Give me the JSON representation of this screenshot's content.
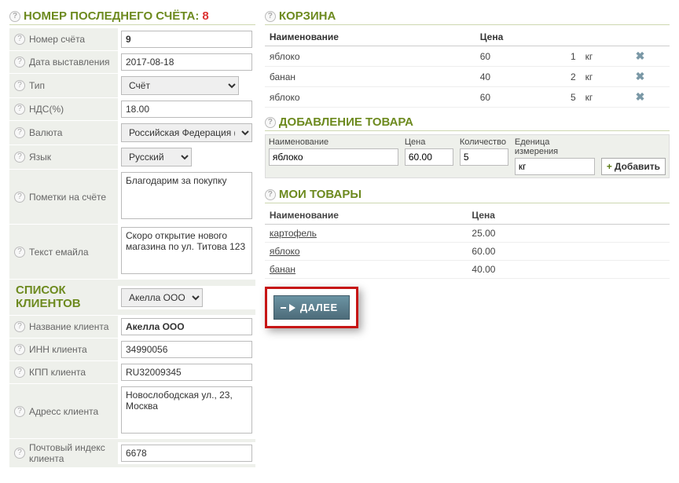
{
  "left": {
    "lastInvoiceTitle": "НОМЕР ПОСЛЕДНЕГО СЧЁТА:",
    "lastInvoiceNo": "8",
    "rows": {
      "number_label": "Номер счёта",
      "number_value": "9",
      "date_label": "Дата выставления",
      "date_value": "2017-08-18",
      "type_label": "Тип",
      "type_value": "Счёт",
      "vat_label": "НДС(%)",
      "vat_value": "18.00",
      "currency_label": "Валюта",
      "currency_value": "Российская Федерация (RUB) р.",
      "lang_label": "Язык",
      "lang_value": "Русский",
      "note_label": "Пометки на счёте",
      "note_value": "Благодарим за покупку",
      "emailtext_label": "Текст емайла",
      "emailtext_value": "Скоро открытие нового магазина по ул. Титова 123"
    },
    "clientsTitle1": "СПИСОК",
    "clientsTitle2": "КЛИЕНТОВ",
    "clientSelect": "Акелла ООО",
    "client": {
      "name_label": "Название клиента",
      "name_value": "Акелла ООО",
      "inn_label": "ИНН клиента",
      "inn_value": "34990056",
      "kpp_label": "КПП клиента",
      "kpp_value": "RU32009345",
      "addr_label": "Адресс клиента",
      "addr_value": "Новослободская ул., 23, Москва",
      "zip_label": "Почтовый индекс клиента",
      "zip_value": "6678"
    }
  },
  "cart": {
    "title": "КОРЗИНА",
    "th_name": "Наименование",
    "th_price": "Цена",
    "rows": [
      {
        "name": "яблоко",
        "price": "60",
        "qty": "1",
        "unit": "кг"
      },
      {
        "name": "банан",
        "price": "40",
        "qty": "2",
        "unit": "кг"
      },
      {
        "name": "яблоко",
        "price": "60",
        "qty": "5",
        "unit": "кг"
      }
    ]
  },
  "add": {
    "title": "ДОБАВЛЕНИЕ ТОВАРА",
    "th_name": "Наименование",
    "th_price": "Цена",
    "th_qty": "Количество",
    "th_unit": "Еденица измерения",
    "name_value": "яблоко",
    "price_value": "60.00",
    "qty_value": "5",
    "unit_value": "кг",
    "btn": "Добавить"
  },
  "goods": {
    "title": "МОИ ТОВАРЫ",
    "th_name": "Наименование",
    "th_price": "Цена",
    "rows": [
      {
        "name": "картофель",
        "price": "25.00"
      },
      {
        "name": "яблоко",
        "price": "60.00"
      },
      {
        "name": "банан",
        "price": "40.00"
      }
    ]
  },
  "nextBtn": "ДАЛЕЕ"
}
